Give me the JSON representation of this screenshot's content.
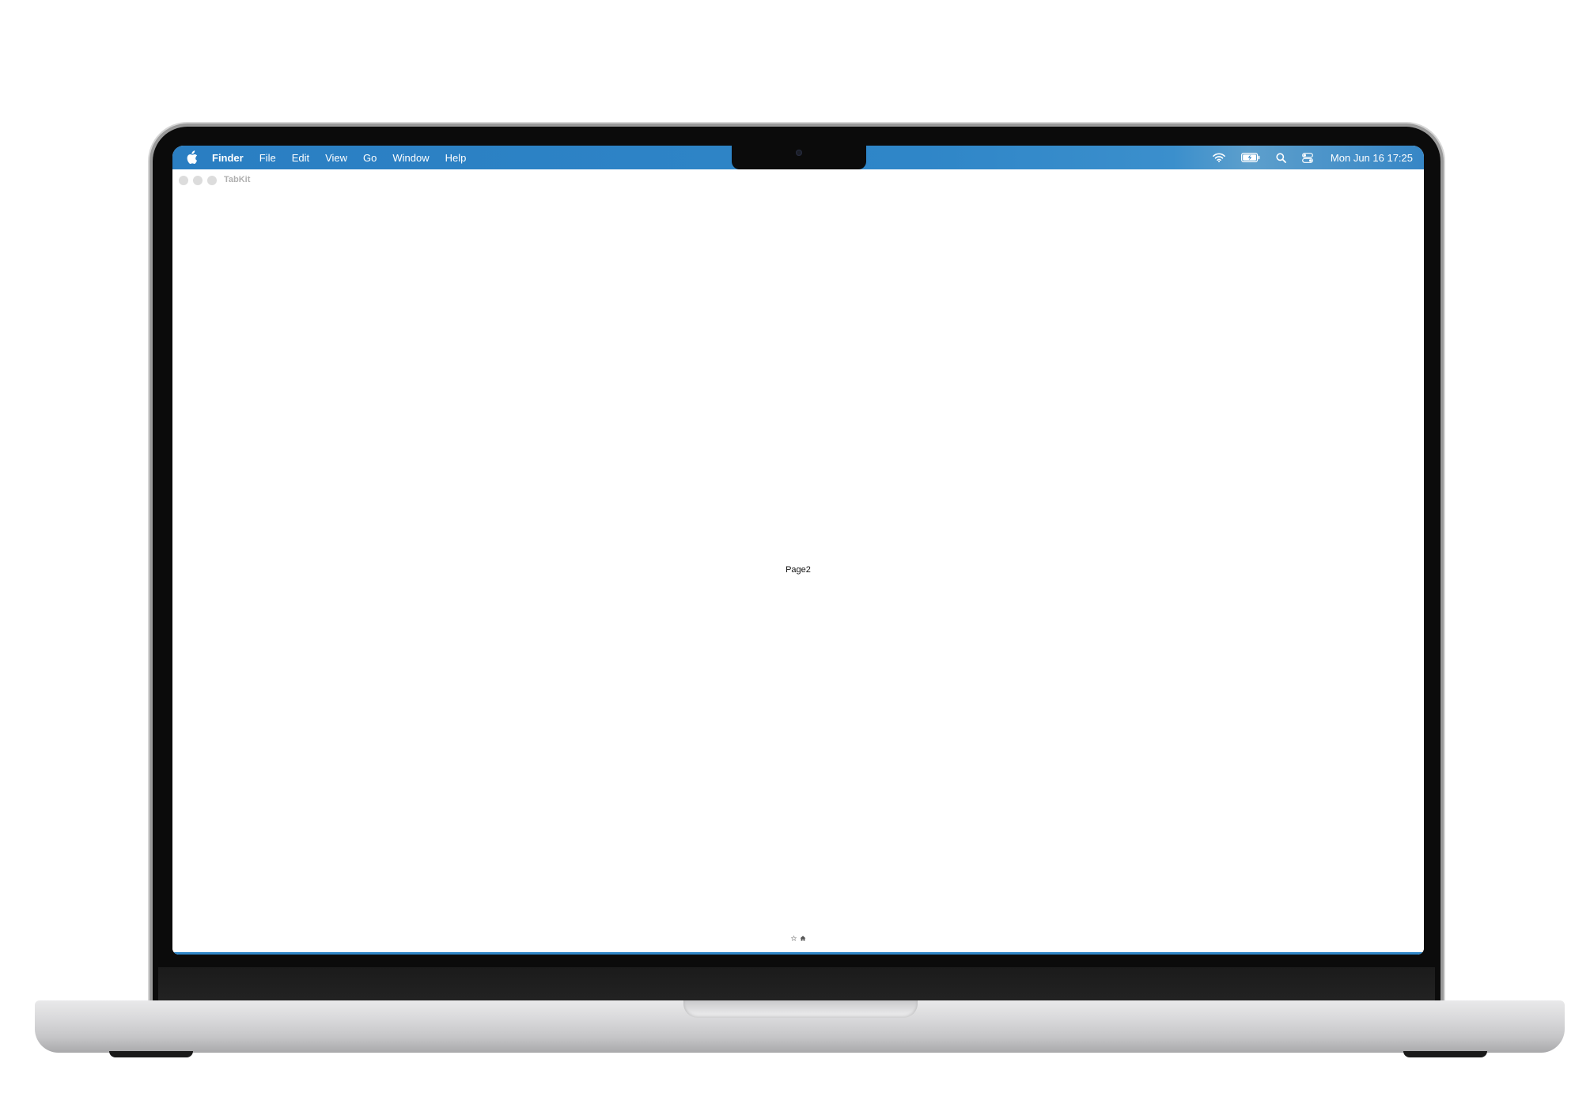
{
  "menubar": {
    "app_name": "Finder",
    "items": [
      "File",
      "Edit",
      "View",
      "Go",
      "Window",
      "Help"
    ],
    "icons": [
      "wifi-icon",
      "battery-icon",
      "search-icon",
      "control-center-icon"
    ],
    "clock": "Mon Jun 16  17:25"
  },
  "window": {
    "title": "TabKit",
    "content_label": "Page2",
    "tab_icons": [
      "star-icon",
      "home-icon"
    ]
  },
  "colors": {
    "menubar_accent": "#2f86c8",
    "window_bg": "#ffffff"
  }
}
